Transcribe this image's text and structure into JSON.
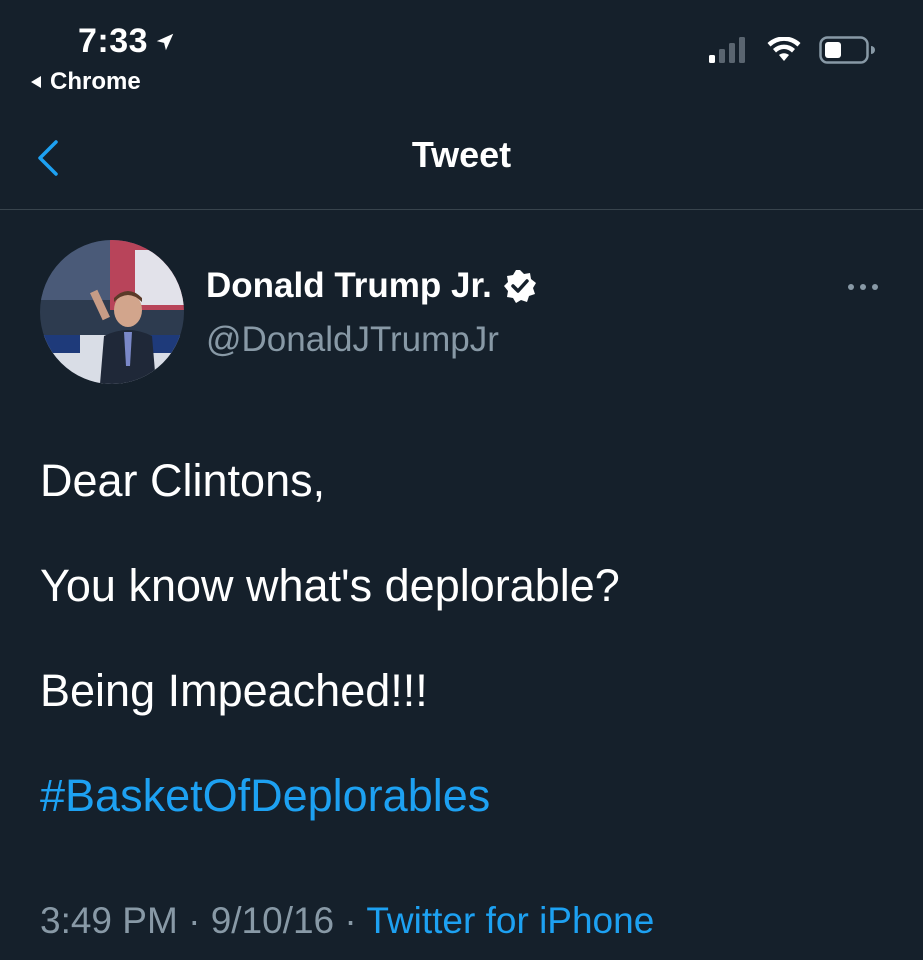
{
  "status_bar": {
    "time": "7:33",
    "back_app": "Chrome"
  },
  "header": {
    "title": "Tweet"
  },
  "author": {
    "name": "Donald Trump Jr.",
    "handle": "@DonaldJTrumpJr"
  },
  "tweet": {
    "lines": [
      "Dear Clintons,",
      "You know what's deplorable?",
      "Being Impeached!!!"
    ],
    "hashtag": "#BasketOfDeplorables",
    "time": "3:49 PM",
    "date": "9/10/16",
    "separator": "·",
    "source": "Twitter for iPhone"
  },
  "colors": {
    "background": "#15202b",
    "accent": "#1da1f2",
    "secondary_text": "#8899a6",
    "divider": "#38444d"
  },
  "icons": {
    "location": "location-arrow-icon",
    "back_app": "back-triangle-icon",
    "signal": "cellular-signal-icon",
    "wifi": "wifi-icon",
    "battery": "battery-icon",
    "nav_back": "chevron-left-icon",
    "verified": "verified-badge-icon",
    "more": "more-horizontal-icon"
  }
}
